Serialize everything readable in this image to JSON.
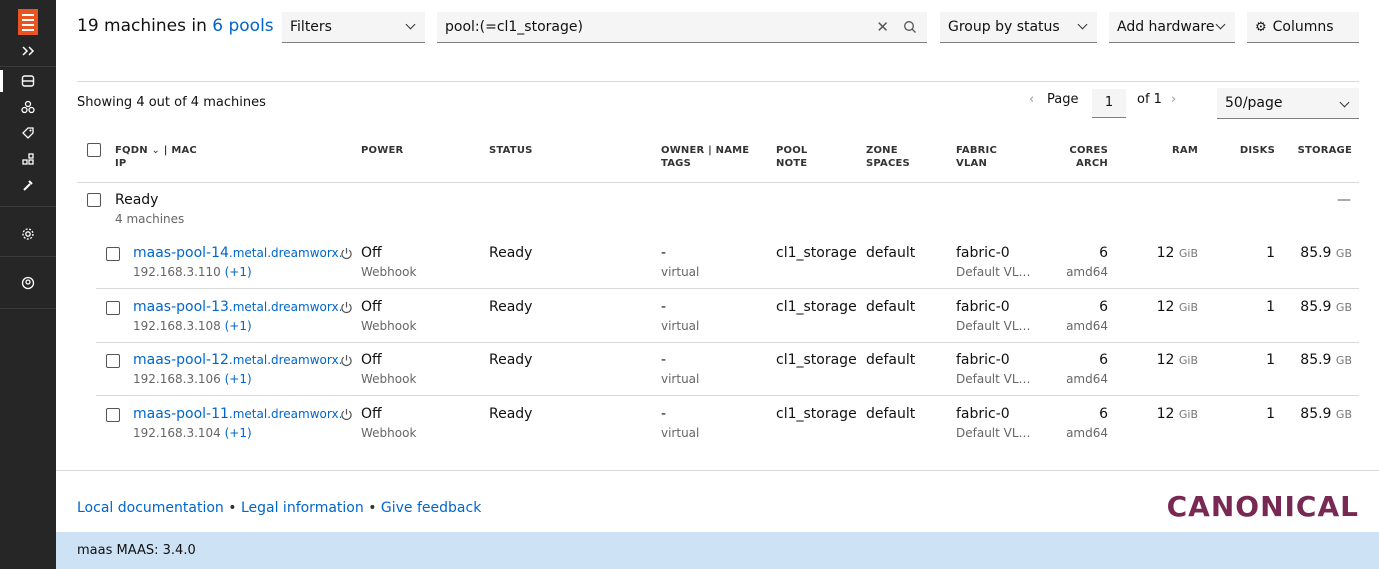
{
  "header": {
    "count_text": "19 machines in",
    "pools_link": "6 pools",
    "filters_label": "Filters",
    "search_value": "pool:(=cl1_storage)",
    "group_by_label": "Group by status",
    "add_hardware_label": "Add hardware",
    "columns_label": "Columns"
  },
  "summary": {
    "showing": "Showing 4 out of 4 machines",
    "page_label": "Page",
    "page_value": "1",
    "of_label": "of 1",
    "per_page": "50/page"
  },
  "columns": {
    "fqdn": "FQDN",
    "mac": "| MAC",
    "ip": "IP",
    "power": "POWER",
    "status": "STATUS",
    "owner": "OWNER | NAME",
    "tags": "TAGS",
    "pool": "POOL",
    "note": "NOTE",
    "zone": "ZONE",
    "spaces": "SPACES",
    "fabric": "FABRIC",
    "vlan": "VLAN",
    "cores": "CORES",
    "arch": "ARCH",
    "ram": "RAM",
    "disks": "DISKS",
    "storage": "STORAGE"
  },
  "group": {
    "name": "Ready",
    "count": "4 machines",
    "collapse": "—"
  },
  "machines": [
    {
      "host": "maas-pool-14",
      "domain": ".metal.dreamworx.",
      "ip": "192.168.3.110",
      "ip_extra": "(+1)",
      "power": "Off",
      "power_type": "Webhook",
      "status": "Ready",
      "owner": "-",
      "tags": "virtual",
      "pool": "cl1_storage",
      "zone": "default",
      "fabric": "fabric-0",
      "vlan": "Default VL…",
      "cores": "6",
      "arch": "amd64",
      "ram": "12",
      "ram_unit": "GiB",
      "disks": "1",
      "storage": "85.9",
      "storage_unit": "GB"
    },
    {
      "host": "maas-pool-13",
      "domain": ".metal.dreamworx.",
      "ip": "192.168.3.108",
      "ip_extra": "(+1)",
      "power": "Off",
      "power_type": "Webhook",
      "status": "Ready",
      "owner": "-",
      "tags": "virtual",
      "pool": "cl1_storage",
      "zone": "default",
      "fabric": "fabric-0",
      "vlan": "Default VL…",
      "cores": "6",
      "arch": "amd64",
      "ram": "12",
      "ram_unit": "GiB",
      "disks": "1",
      "storage": "85.9",
      "storage_unit": "GB"
    },
    {
      "host": "maas-pool-12",
      "domain": ".metal.dreamworx.",
      "ip": "192.168.3.106",
      "ip_extra": "(+1)",
      "power": "Off",
      "power_type": "Webhook",
      "status": "Ready",
      "owner": "-",
      "tags": "virtual",
      "pool": "cl1_storage",
      "zone": "default",
      "fabric": "fabric-0",
      "vlan": "Default VL…",
      "cores": "6",
      "arch": "amd64",
      "ram": "12",
      "ram_unit": "GiB",
      "disks": "1",
      "storage": "85.9",
      "storage_unit": "GB"
    },
    {
      "host": "maas-pool-11",
      "domain": ".metal.dreamworx.",
      "ip": "192.168.3.104",
      "ip_extra": "(+1)",
      "power": "Off",
      "power_type": "Webhook",
      "status": "Ready",
      "owner": "-",
      "tags": "virtual",
      "pool": "cl1_storage",
      "zone": "default",
      "fabric": "fabric-0",
      "vlan": "Default VL…",
      "cores": "6",
      "arch": "amd64",
      "ram": "12",
      "ram_unit": "GiB",
      "disks": "1",
      "storage": "85.9",
      "storage_unit": "GB"
    }
  ],
  "footer": {
    "doc_link": "Local documentation",
    "legal_link": "Legal information",
    "feedback_link": "Give feedback",
    "separator": "•",
    "brand": "CANONICAL",
    "status_prefix": "maas MAAS:",
    "version": "3.4.0"
  },
  "icons": {
    "sidebar": [
      "menu-logo-icon",
      "expand-icon",
      "machines-icon",
      "pools-icon",
      "tags-icon",
      "zones-icon",
      "kvm-icon",
      "settings-icon",
      "user-icon"
    ]
  },
  "colors": {
    "accent": "#e95420",
    "link": "#0066cc",
    "brand": "#772953",
    "statusbar": "#cde2f4",
    "sidebar": "#262626"
  }
}
